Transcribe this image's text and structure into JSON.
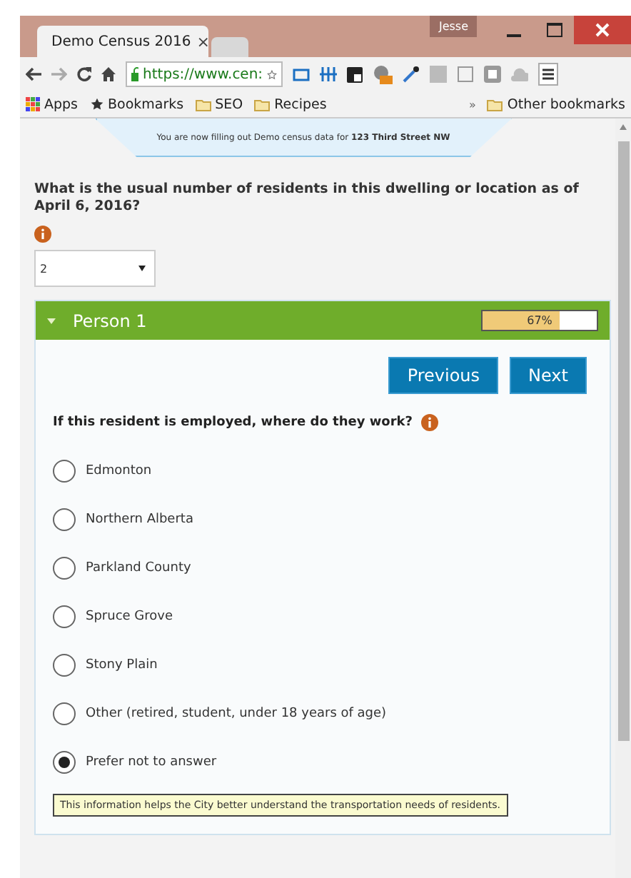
{
  "window": {
    "user": "Jesse"
  },
  "tabs": [
    {
      "title": "Demo Census 2016",
      "close": "×",
      "selected": true
    },
    {
      "selected": false
    }
  ],
  "address": {
    "value": "https://www.cen:"
  },
  "bookmarks": [
    {
      "label": "Apps",
      "kind": "apps"
    },
    {
      "label": "Bookmarks",
      "kind": "star"
    },
    {
      "label": "SEO",
      "kind": "folder"
    },
    {
      "label": "Recipes",
      "kind": "folder"
    }
  ],
  "bookmarks_more": {
    "chevron": "»",
    "label": "Other bookmarks"
  },
  "banner": {
    "text": "You are now filling out Demo census data for **123 Third Street NW**"
  },
  "question": {
    "text": "What is the usual number of residents in this dwelling or location as of April 6, 2016?",
    "value": "2"
  },
  "person": {
    "title": "Person 1",
    "expanded": true,
    "level": 0.67,
    "reading": "67%"
  },
  "buttons": [
    "Previous",
    "Next"
  ],
  "work_question": "If this resident is employed, where do they work?",
  "options": [
    {
      "label": "Edmonton",
      "selected": false
    },
    {
      "label": "Northern Alberta",
      "selected": false
    },
    {
      "label": "Parkland County",
      "selected": false
    },
    {
      "label": "Spruce Grove",
      "selected": false
    },
    {
      "label": "Stony Plain",
      "selected": false
    },
    {
      "label": "Other (retired, student, under 18 years of age)",
      "selected": false
    },
    {
      "label": "Prefer not to answer",
      "selected": true
    }
  ],
  "hint": "This information helps the City better understand the transportation needs of residents."
}
